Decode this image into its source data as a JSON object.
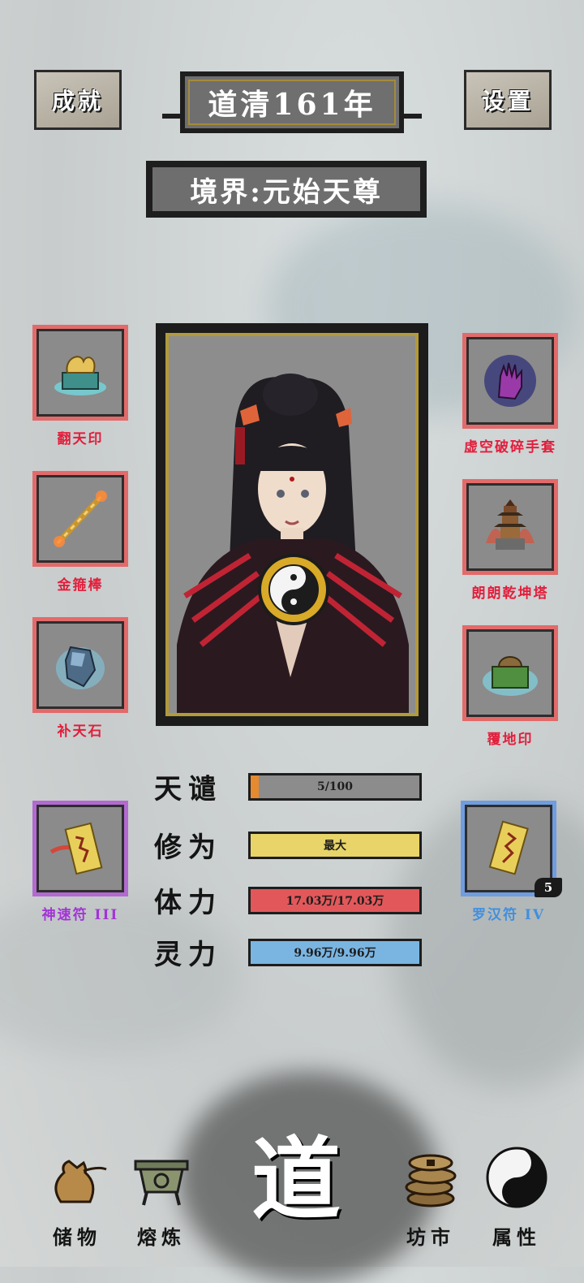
{
  "header": {
    "achievements_label": "成就",
    "year_label": "道清161年",
    "settings_label": "设置",
    "realm_label": "境界:元始天尊"
  },
  "equipment_left": [
    {
      "name": "翻天印",
      "icon": "dragon-seal-icon"
    },
    {
      "name": "金箍棒",
      "icon": "golden-staff-icon"
    },
    {
      "name": "补天石",
      "icon": "crystal-stone-icon"
    }
  ],
  "equipment_right": [
    {
      "name": "虚空破碎手套",
      "icon": "void-glove-icon"
    },
    {
      "name": "朗朗乾坤塔",
      "icon": "pagoda-icon"
    },
    {
      "name": "覆地印",
      "icon": "earth-seal-icon"
    }
  ],
  "talismans": {
    "left": {
      "name": "神速符 III",
      "icon": "talisman-icon",
      "rarity_color": "#b26ad0"
    },
    "right": {
      "name": "罗汉符 IV",
      "icon": "talisman-icon",
      "rarity_color": "#6f9de0",
      "count": "5"
    }
  },
  "stats": [
    {
      "name": "天谴",
      "value": "5/100",
      "fill": 0.05,
      "color": "#e58a2f",
      "track": "#8c8c8c"
    },
    {
      "name": "修为",
      "value": "最大",
      "fill": 1.0,
      "color": "#e8d468",
      "track": "#e8d468"
    },
    {
      "name": "体力",
      "value": "17.03万/17.03万",
      "fill": 1.0,
      "color": "#e2585a",
      "track": "#e2585a"
    },
    {
      "name": "灵力",
      "value": "9.96万/9.96万",
      "fill": 1.0,
      "color": "#7ab5e2",
      "track": "#7ab5e2"
    }
  ],
  "nav": {
    "storage": "储物",
    "refine": "熔炼",
    "center": "道",
    "market": "坊市",
    "attributes": "属性"
  },
  "colors": {
    "equip_border": "#e36a6a",
    "equip_label": "#e21e3c",
    "frame_gold": "#b39a3a"
  }
}
